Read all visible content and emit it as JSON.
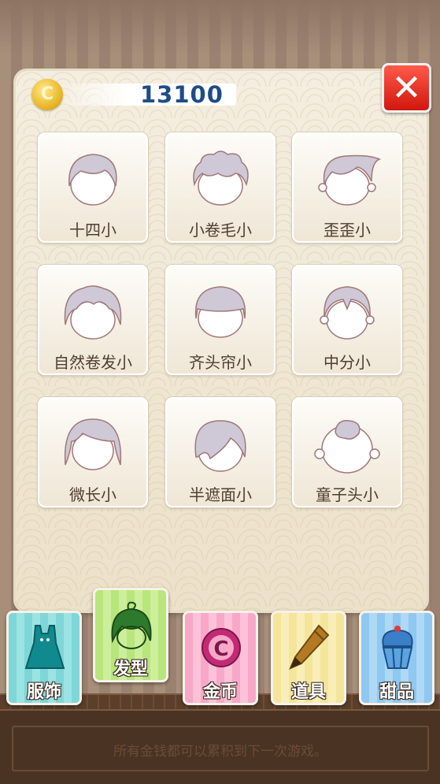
{
  "coins": {
    "value": "13100"
  },
  "close_label": "✕",
  "hairstyles": [
    {
      "label": "十四小",
      "icon": "hair-short-icon"
    },
    {
      "label": "小卷毛小",
      "icon": "hair-curly-icon"
    },
    {
      "label": "歪歪小",
      "icon": "hair-side-swept-icon"
    },
    {
      "label": "自然卷发小",
      "icon": "hair-natural-curl-icon"
    },
    {
      "label": "齐头帘小",
      "icon": "hair-straight-bangs-icon"
    },
    {
      "label": "中分小",
      "icon": "hair-middle-part-icon"
    },
    {
      "label": "微长小",
      "icon": "hair-medium-long-icon"
    },
    {
      "label": "半遮面小",
      "icon": "hair-half-cover-icon"
    },
    {
      "label": "童子头小",
      "icon": "hair-child-tuft-icon"
    }
  ],
  "tabs": [
    {
      "label": "服饰",
      "icon": "dress-icon",
      "color": "#7fd6d8"
    },
    {
      "label": "发型",
      "icon": "hair-icon",
      "color": "#b9e57d",
      "active": true
    },
    {
      "label": "金币",
      "icon": "coin-c-icon",
      "color": "#f7a8c8"
    },
    {
      "label": "道具",
      "icon": "pencil-icon",
      "color": "#f5e59a"
    },
    {
      "label": "甜品",
      "icon": "cupcake-icon",
      "color": "#8fc8f0"
    }
  ],
  "notice": "所有金钱都可以累积到下一次游戏。"
}
